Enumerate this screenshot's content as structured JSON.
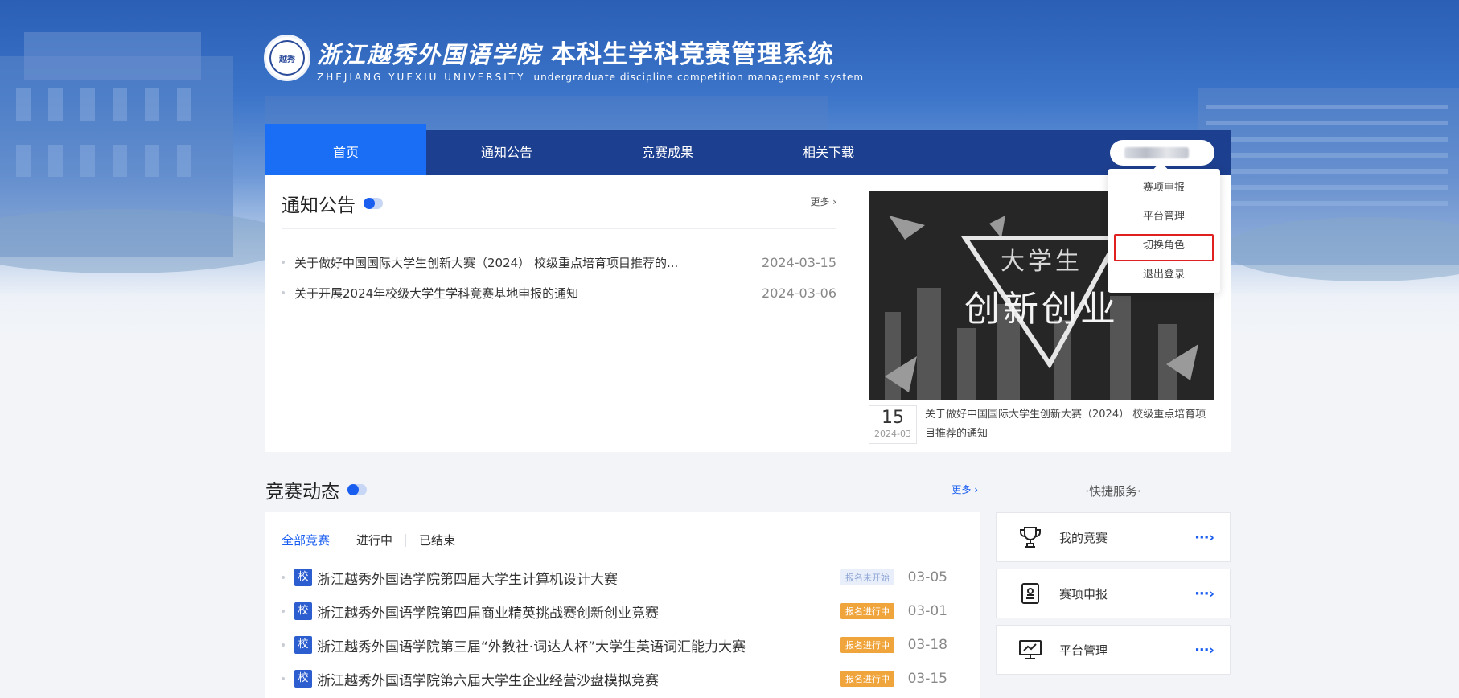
{
  "header": {
    "emblem_text": "越秀",
    "school_cn": "浙江越秀外国语学院",
    "system_cn": "本科生学科竞赛管理系统",
    "school_en": "ZHEJIANG   YUEXIU   UNIVERSITY",
    "system_en": "undergraduate discipline competition management system"
  },
  "nav": {
    "items": [
      {
        "label": "首页",
        "active": true
      },
      {
        "label": "通知公告"
      },
      {
        "label": "竞赛成果"
      },
      {
        "label": "相关下载"
      }
    ]
  },
  "user_menu": {
    "items": [
      {
        "label": "赛项申报"
      },
      {
        "label": "平台管理"
      },
      {
        "label": "切换角色",
        "highlighted": true
      },
      {
        "label": "退出登录"
      }
    ]
  },
  "notice": {
    "title": "通知公告",
    "more": "更多 ›",
    "items": [
      {
        "title": "关于做好中国国际大学生创新大赛（2024） 校级重点培育项目推荐的...",
        "date": "2024-03-15"
      },
      {
        "title": "关于开展2024年校级大学生学科竞赛基地申报的通知",
        "date": "2024-03-06"
      }
    ]
  },
  "feature": {
    "image_line1": "大学生",
    "image_line2": "创新创业",
    "day": "15",
    "year_month": "2024-03",
    "caption": "关于做好中国国际大学生创新大赛（2024） 校级重点培育项目推荐的通知"
  },
  "competition": {
    "title": "竞赛动态",
    "more": "更多 ›",
    "tabs": [
      {
        "label": "全部竞赛",
        "active": true
      },
      {
        "label": "进行中"
      },
      {
        "label": "已结束"
      }
    ],
    "tag": "校",
    "items": [
      {
        "title": "浙江越秀外国语学院第四届大学生计算机设计大赛",
        "status": "报名未开始",
        "status_type": "pending",
        "date": "03-05"
      },
      {
        "title": "浙江越秀外国语学院第四届商业精英挑战赛创新创业竞赛",
        "status": "报名进行中",
        "status_type": "ongoing",
        "date": "03-01"
      },
      {
        "title": "浙江越秀外国语学院第三届“外教社·词达人杯”大学生英语词汇能力大赛",
        "status": "报名进行中",
        "status_type": "ongoing",
        "date": "03-18"
      },
      {
        "title": "浙江越秀外国语学院第六届大学生企业经营沙盘模拟竞赛",
        "status": "报名进行中",
        "status_type": "ongoing",
        "date": "03-15"
      }
    ]
  },
  "quick_services": {
    "title": "·快捷服务·",
    "items": [
      {
        "label": "我的竞赛",
        "icon": "trophy-icon"
      },
      {
        "label": "赛项申报",
        "icon": "badge-icon"
      },
      {
        "label": "平台管理",
        "icon": "monitor-chart-icon"
      }
    ],
    "arrow": "···›"
  }
}
